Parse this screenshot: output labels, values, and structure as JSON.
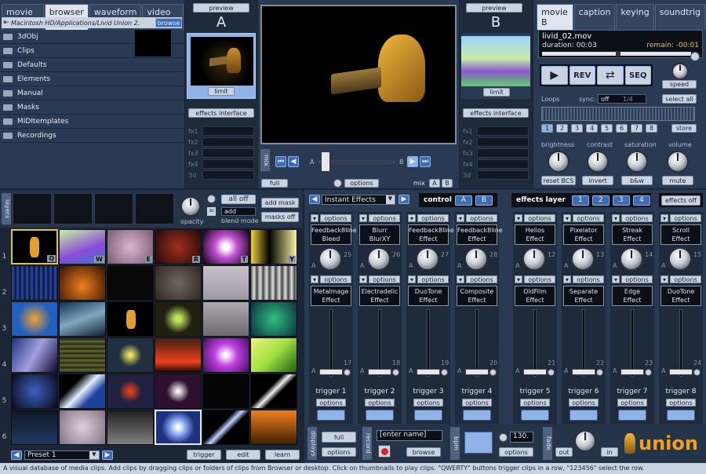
{
  "browser": {
    "tabs": [
      "movie A",
      "browser",
      "waveform",
      "video in"
    ],
    "active_tab": 1,
    "path": "Macintosh HD/Applications/Livid Union 2.",
    "browse_label": "browse",
    "folders": [
      "3dObj",
      "Clips",
      "Defaults",
      "Elements",
      "Manual",
      "Masks",
      "MIDItemplates",
      "Recordings"
    ]
  },
  "preview": {
    "a_btn": "preview",
    "a_letter": "A",
    "b_btn": "preview",
    "b_letter": "B",
    "limit": "limit",
    "effects_interface": "effects interface",
    "fx_labels": [
      "fx1",
      "fx2",
      "fx3",
      "fx4",
      "3d"
    ]
  },
  "main_preview": {
    "title": "mix",
    "a": "A",
    "b": "B",
    "full": "full",
    "options": "options",
    "mix": "mix",
    "mix_a": "A",
    "mix_b": "B",
    "logo_text": "union"
  },
  "movieb": {
    "tabs": [
      "movie B",
      "caption",
      "keying",
      "soundtrig"
    ],
    "active_tab": 0,
    "file": "livid_02.mov",
    "duration": "duration: 00:03",
    "remain": "remain: -00:01",
    "rev": "REV",
    "seq": "SEQ",
    "speed": "speed",
    "loops": "Loops",
    "sync": "sync:",
    "sync_value": "off",
    "sync_ratio": "1/4",
    "select_all": "select all",
    "loop_nums": [
      "1",
      "2",
      "3",
      "4",
      "5",
      "6",
      "7",
      "8"
    ],
    "store": "store",
    "bcs": [
      "brightness",
      "contrast",
      "saturation",
      "volume"
    ],
    "bcs_buttons": [
      "reset BCS",
      "invert",
      "b&w",
      "mute"
    ]
  },
  "layers": {
    "title": "layers",
    "all_off": "all off",
    "add": "add",
    "blend_mode": "blend mode",
    "opacity": "opacity",
    "add_mask": "add mask",
    "masks_off": "masks off"
  },
  "grid": {
    "row_nums": [
      "1",
      "2",
      "3",
      "4",
      "5",
      "6"
    ],
    "keys": [
      "Q",
      "W",
      "E",
      "R",
      "T",
      "Y"
    ],
    "preset": "Preset 1",
    "trigger": "trigger",
    "edit": "edit",
    "learn": "learn"
  },
  "fx": {
    "instant": "Instant Effects",
    "control": "control",
    "control_a": "A",
    "control_b": "B",
    "effects_layer": "effects layer",
    "layer_nums": [
      "1",
      "2",
      "3",
      "4"
    ],
    "effects_off": "effects off",
    "options": "options",
    "top": [
      [
        "Feedback8line",
        "Bleed"
      ],
      [
        "Blurr",
        "BlurXY"
      ],
      [
        "Feedback8line",
        "Effect"
      ],
      [
        "Feedback8line",
        "Effect"
      ],
      [
        "Helios",
        "Effect"
      ],
      [
        "Pixelator",
        "Effect"
      ],
      [
        "Streak",
        "Effect"
      ],
      [
        "Scroll",
        "Effect"
      ]
    ],
    "knob_nums": [
      "25",
      "26",
      "27",
      "28",
      "12",
      "13",
      "14",
      "15"
    ],
    "bottom": [
      [
        "Metalmage",
        "Effect"
      ],
      [
        "Electradelic",
        "Effect"
      ],
      [
        "DuoTone",
        "Effect"
      ],
      [
        "Composite",
        "Effect"
      ],
      [
        "OldFilm",
        "Effect"
      ],
      [
        "Separate",
        "Effect"
      ],
      [
        "Edge",
        "Effect"
      ],
      [
        "DuoTone",
        "Effect"
      ]
    ],
    "slider_nums": [
      "17",
      "18",
      "19",
      "20",
      "21",
      "22",
      "23",
      "24"
    ],
    "triggers": [
      "trigger 1",
      "trigger 2",
      "trigger 3",
      "trigger 4",
      "trigger 5",
      "trigger 6",
      "trigger 7",
      "trigger 8"
    ]
  },
  "bottom": {
    "displays": "displays",
    "full": "full",
    "options": "options",
    "record": "record",
    "name_placeholder": "[enter name]",
    "browse": "browse",
    "bpm": "bpm",
    "bpm_value": "130.",
    "bpm_options": "options",
    "fade": "fade",
    "out": "out",
    "in": "in",
    "logo": "union"
  },
  "status": "A visual database of media clips. Add clips by dragging clips or folders of clips from Browser or desktop. Click on thumbnails to play clips. \"QWERTY\" buttons trigger clips in a row, \"123456\" select the row."
}
